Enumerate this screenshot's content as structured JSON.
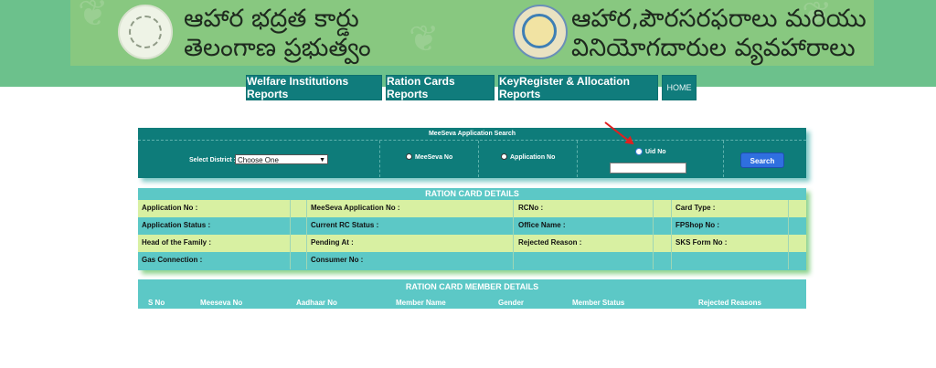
{
  "banner": {
    "title_left_line1": "ఆహార భద్రత కార్డు",
    "title_left_line2": "తెలంగాణ ప్రభుత్వం",
    "title_right_line1": "ఆహార,పౌరసరఫరాలు మరియు",
    "title_right_line2": "వినియోగదారుల వ్యవహారాలు"
  },
  "nav": {
    "items": [
      {
        "label": "Welfare Institutions Reports"
      },
      {
        "label": "Ration Cards Reports"
      },
      {
        "label": "KeyRegister & Allocation Reports"
      },
      {
        "label": "HOME"
      }
    ]
  },
  "search": {
    "title": "MeeSeva Application Search",
    "district_label": "Select District :",
    "district_value": "Choose One",
    "meeseva_label": "MeeSeva No",
    "application_label": "Application No",
    "uid_label": "Uid No",
    "uid_value": "",
    "search_button": "Search"
  },
  "ration_card": {
    "title": "RATION CARD DETAILS",
    "rows": [
      [
        "Application No :",
        "MeeSeva Application No :",
        "RCNo :",
        "Card Type :"
      ],
      [
        "Application Status :",
        "Current RC Status :",
        "Office Name :",
        "FPShop No :"
      ],
      [
        "Head of the Family :",
        "Pending At :",
        "Rejected Reason :",
        "SKS Form No :"
      ],
      [
        "Gas Connection :",
        "Consumer No :",
        "",
        ""
      ]
    ]
  },
  "member": {
    "title": "RATION CARD MEMBER DETAILS",
    "headers": [
      "S No",
      "Meeseva No",
      "Aadhaar No",
      "Member Name",
      "Gender",
      "Member Status",
      "Rejected Reasons"
    ]
  },
  "colors": {
    "header_green": "#6cc18c",
    "banner_green": "#88c880",
    "nav_teal": "#107c7c",
    "panel_teal": "#0e7c7a",
    "table_teal": "#5cc8c6",
    "row_light": "#d8f0a2",
    "search_blue": "#2f6fe0"
  }
}
